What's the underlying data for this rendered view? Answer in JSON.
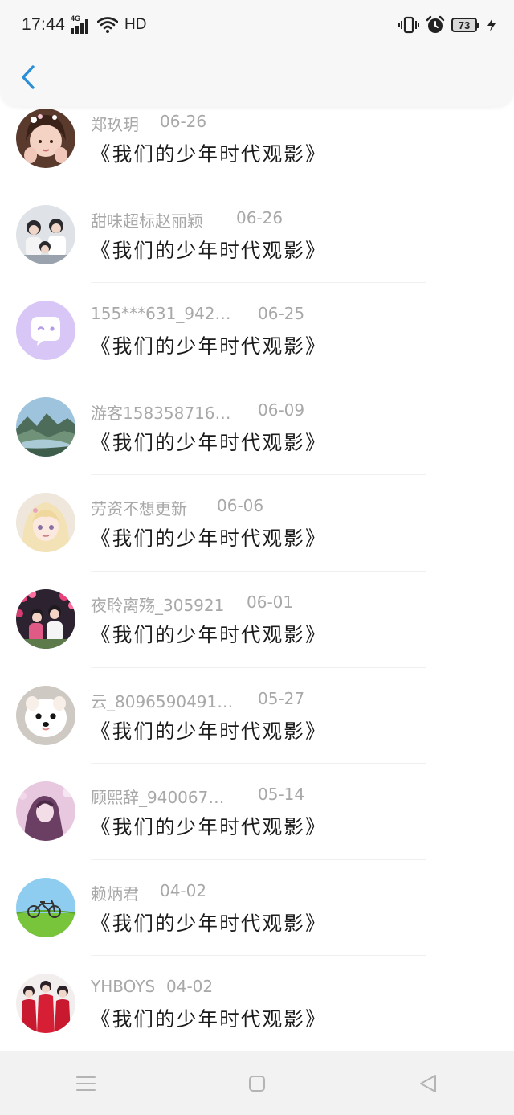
{
  "status_bar": {
    "time": "17:44",
    "network": "4G",
    "hd": "HD",
    "battery": "73"
  },
  "header": {
    "back_icon": "chevron-left-icon"
  },
  "entries": [
    {
      "name": "郑玖玥",
      "date": "06-26",
      "title": "《我们的少年时代观影》"
    },
    {
      "name": "甜味超标赵丽颖",
      "date": "06-26",
      "title": "《我们的少年时代观影》"
    },
    {
      "name": "155***631_942…",
      "date": "06-25",
      "title": "《我们的少年时代观影》"
    },
    {
      "name": "游客158358716…",
      "date": "06-09",
      "title": "《我们的少年时代观影》"
    },
    {
      "name": "劳资不想更新",
      "date": "06-06",
      "title": "《我们的少年时代观影》"
    },
    {
      "name": "夜聆离殇_305921",
      "date": "06-01",
      "title": "《我们的少年时代观影》"
    },
    {
      "name": "云_8096590491…",
      "date": "05-27",
      "title": "《我们的少年时代观影》"
    },
    {
      "name": "顾熙辞_940067…",
      "date": "05-14",
      "title": "《我们的少年时代观影》"
    },
    {
      "name": "赖炳君",
      "date": "04-02",
      "title": "《我们的少年时代观影》"
    },
    {
      "name": "YHBOYS",
      "date": "04-02",
      "title": "《我们的少年时代观影》"
    }
  ],
  "colors": {
    "accent": "#2b8ed6",
    "meta_text": "#a8a8a8",
    "title_text": "#1b1b1b"
  }
}
